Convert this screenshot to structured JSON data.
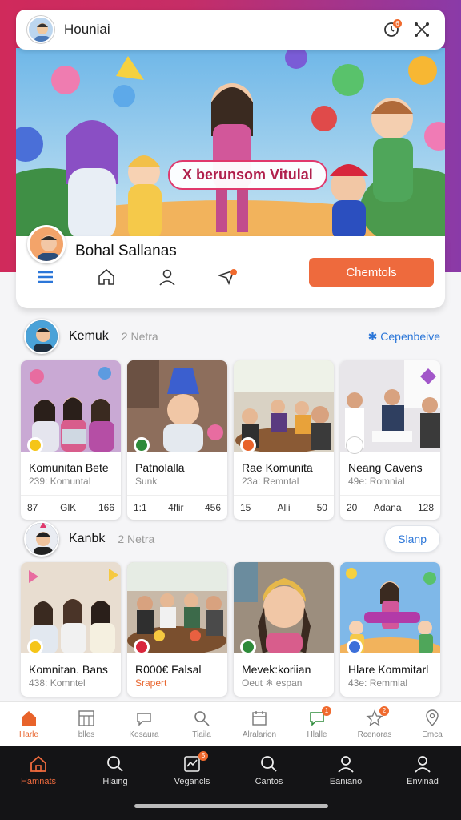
{
  "app_bar": {
    "title": "Houniai",
    "notification_badge": "6"
  },
  "hero": {
    "banner_text": "X berunsom Vitulal"
  },
  "profile": {
    "name": "Bohal Sallanas",
    "primary_button": "Chemtols"
  },
  "sections": [
    {
      "title": "Kemuk",
      "count": "2 Netra",
      "action": "✱ Cepenbeive",
      "cards": [
        {
          "title": "Komunitan Bete",
          "subtitle": "239: Komuntal",
          "stats": [
            "87",
            "GlK",
            "166"
          ],
          "dot_color": "#f5c518"
        },
        {
          "title": "Patnolalla",
          "subtitle": "Sunk",
          "stats": [
            "1:1",
            "4flir",
            "456"
          ],
          "dot_color": "#2e8b3a"
        },
        {
          "title": "Rae Komunita",
          "subtitle": "23a: Remntal",
          "stats": [
            "15",
            "Alli",
            "50"
          ],
          "dot_color": "#e8632b"
        },
        {
          "title": "Neang Cavens",
          "subtitle": "49e: Romnial",
          "stats": [
            "20",
            "Adana",
            "128"
          ],
          "dot_color": "#ffffff"
        }
      ]
    },
    {
      "title": "Kanbk",
      "count": "2 Netra",
      "action": "Slanp",
      "cards": [
        {
          "title": "Komnitan. Bans",
          "subtitle": "438: Komntel",
          "dot_color": "#f5c518",
          "sub_orange": false
        },
        {
          "title": "R000€ Falsal",
          "subtitle": "Srapert",
          "dot_color": "#d9263c",
          "sub_orange": true
        },
        {
          "title": "Mevek:koriian",
          "subtitle": "Oeut ❄ espan",
          "dot_color": "#2e8b3a",
          "sub_orange": false
        },
        {
          "title": "Hlare Kommitarl",
          "subtitle": "43e: Remmial",
          "dot_color": "#3c6fd9",
          "sub_orange": false
        }
      ]
    }
  ],
  "tabbar_light": [
    {
      "label": "Harle",
      "icon": "home-icon",
      "active": true
    },
    {
      "label": "blles",
      "icon": "grid-icon"
    },
    {
      "label": "Kosaura",
      "icon": "chat-bubble-icon"
    },
    {
      "label": "Tiaila",
      "icon": "search-icon"
    },
    {
      "label": "Alralarion",
      "icon": "calendar-icon"
    },
    {
      "label": "Hlalle",
      "icon": "message-icon",
      "badge": "1"
    },
    {
      "label": "Rcenoras",
      "icon": "star-icon",
      "badge": "2"
    },
    {
      "label": "Emca",
      "icon": "location-pin-icon"
    }
  ],
  "tabbar_dark": [
    {
      "label": "Hamnats",
      "icon": "home-icon",
      "active": true
    },
    {
      "label": "Hlaing",
      "icon": "search-icon"
    },
    {
      "label": "Vegancls",
      "icon": "chart-icon",
      "badge": "5"
    },
    {
      "label": "Cantos",
      "icon": "search-icon"
    },
    {
      "label": "Eaniano",
      "icon": "person-icon"
    },
    {
      "label": "Envinad",
      "icon": "person-icon"
    }
  ],
  "colors": {
    "accent": "#ee6a3d",
    "link": "#2b76d8",
    "header_gradient_start": "#d02a5b",
    "header_gradient_end": "#8a3aa8"
  }
}
